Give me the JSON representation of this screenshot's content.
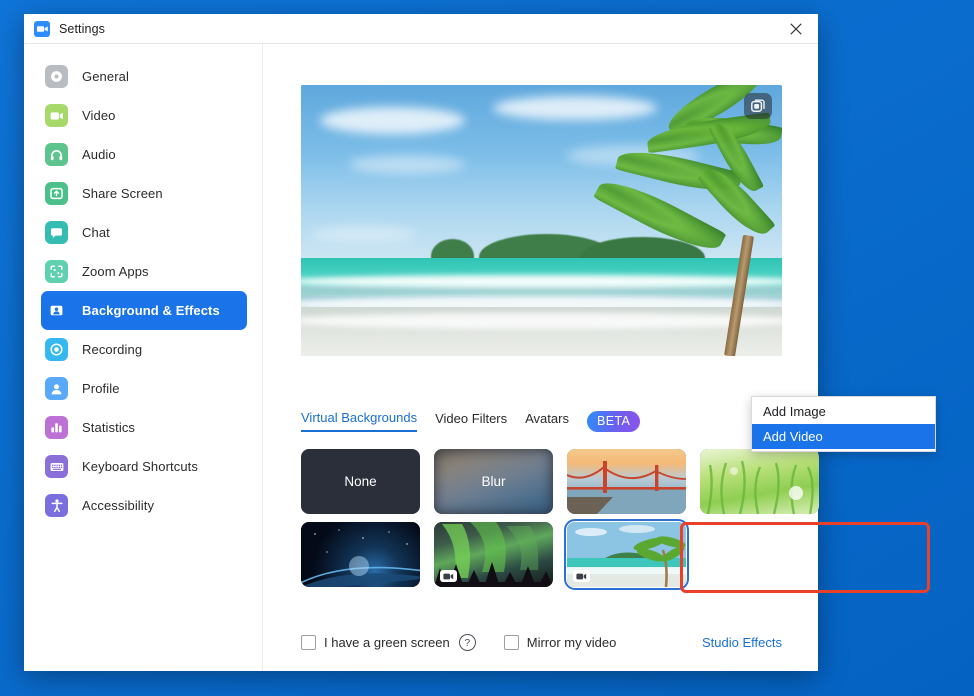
{
  "window": {
    "title": "Settings",
    "app_icon": "zoom-logo-icon",
    "close_icon": "close-icon"
  },
  "sidebar": {
    "items": [
      {
        "label": "General",
        "icon": "gear-icon",
        "color": "#b9bcc0",
        "active": false
      },
      {
        "label": "Video",
        "icon": "video-camera-icon",
        "color": "#a6d96a",
        "active": false
      },
      {
        "label": "Audio",
        "icon": "headphones-icon",
        "color": "#5cc48c",
        "active": false
      },
      {
        "label": "Share Screen",
        "icon": "share-screen-icon",
        "color": "#4cc08a",
        "active": false
      },
      {
        "label": "Chat",
        "icon": "chat-bubble-icon",
        "color": "#35bdb4",
        "active": false
      },
      {
        "label": "Zoom Apps",
        "icon": "zoom-apps-icon",
        "color": "#5fd0b0",
        "active": false
      },
      {
        "label": "Background & Effects",
        "icon": "person-card-icon",
        "color": "#1a73e8",
        "active": true
      },
      {
        "label": "Recording",
        "icon": "record-icon",
        "color": "#35b8f0",
        "active": false
      },
      {
        "label": "Profile",
        "icon": "person-icon",
        "color": "#5aa9f8",
        "active": false
      },
      {
        "label": "Statistics",
        "icon": "bar-chart-icon",
        "color": "#bd71d6",
        "active": false
      },
      {
        "label": "Keyboard Shortcuts",
        "icon": "keyboard-icon",
        "color": "#8a6fd8",
        "active": false
      },
      {
        "label": "Accessibility",
        "icon": "accessibility-icon",
        "color": "#7b6fe0",
        "active": false
      }
    ]
  },
  "preview": {
    "description": "tropical beach with palm tree video preview",
    "pip_icon": "picture-in-picture-icon"
  },
  "tabs": [
    {
      "label": "Virtual Backgrounds",
      "active": true
    },
    {
      "label": "Video Filters",
      "active": false
    },
    {
      "label": "Avatars",
      "active": false
    }
  ],
  "beta_badge": "BETA",
  "add_button": {
    "icon": "plus-icon",
    "highlight_color": "#e8402a"
  },
  "backgrounds": {
    "row1": [
      {
        "name": "None",
        "label": "None",
        "art": "art-none",
        "type": "image",
        "selected": false
      },
      {
        "name": "Blur",
        "label": "Blur",
        "art": "art-blur",
        "type": "image",
        "selected": false
      },
      {
        "name": "Golden Gate Bridge",
        "label": "",
        "art": "art-bridge",
        "type": "image",
        "selected": false
      },
      {
        "name": "Grass",
        "label": "",
        "art": "art-grass",
        "type": "image",
        "selected": false
      }
    ],
    "row2": [
      {
        "name": "Earth from space",
        "label": "",
        "art": "art-earth",
        "type": "image",
        "selected": false
      },
      {
        "name": "Aurora forest",
        "label": "",
        "art": "art-aurora",
        "type": "video",
        "selected": false
      },
      {
        "name": "Tropical beach",
        "label": "",
        "art": "art-beach2",
        "type": "video",
        "selected": true
      }
    ]
  },
  "bottom": {
    "green_screen_label": "I have a green screen",
    "green_screen_checked": false,
    "help_icon": "question-mark-icon",
    "mirror_label": "Mirror my video",
    "mirror_checked": false,
    "studio_effects_label": "Studio Effects",
    "studio_effects_color": "#1a6fd4"
  },
  "menu": {
    "items": [
      {
        "label": "Add Image",
        "highlighted": false
      },
      {
        "label": "Add Video",
        "highlighted": true
      }
    ]
  }
}
